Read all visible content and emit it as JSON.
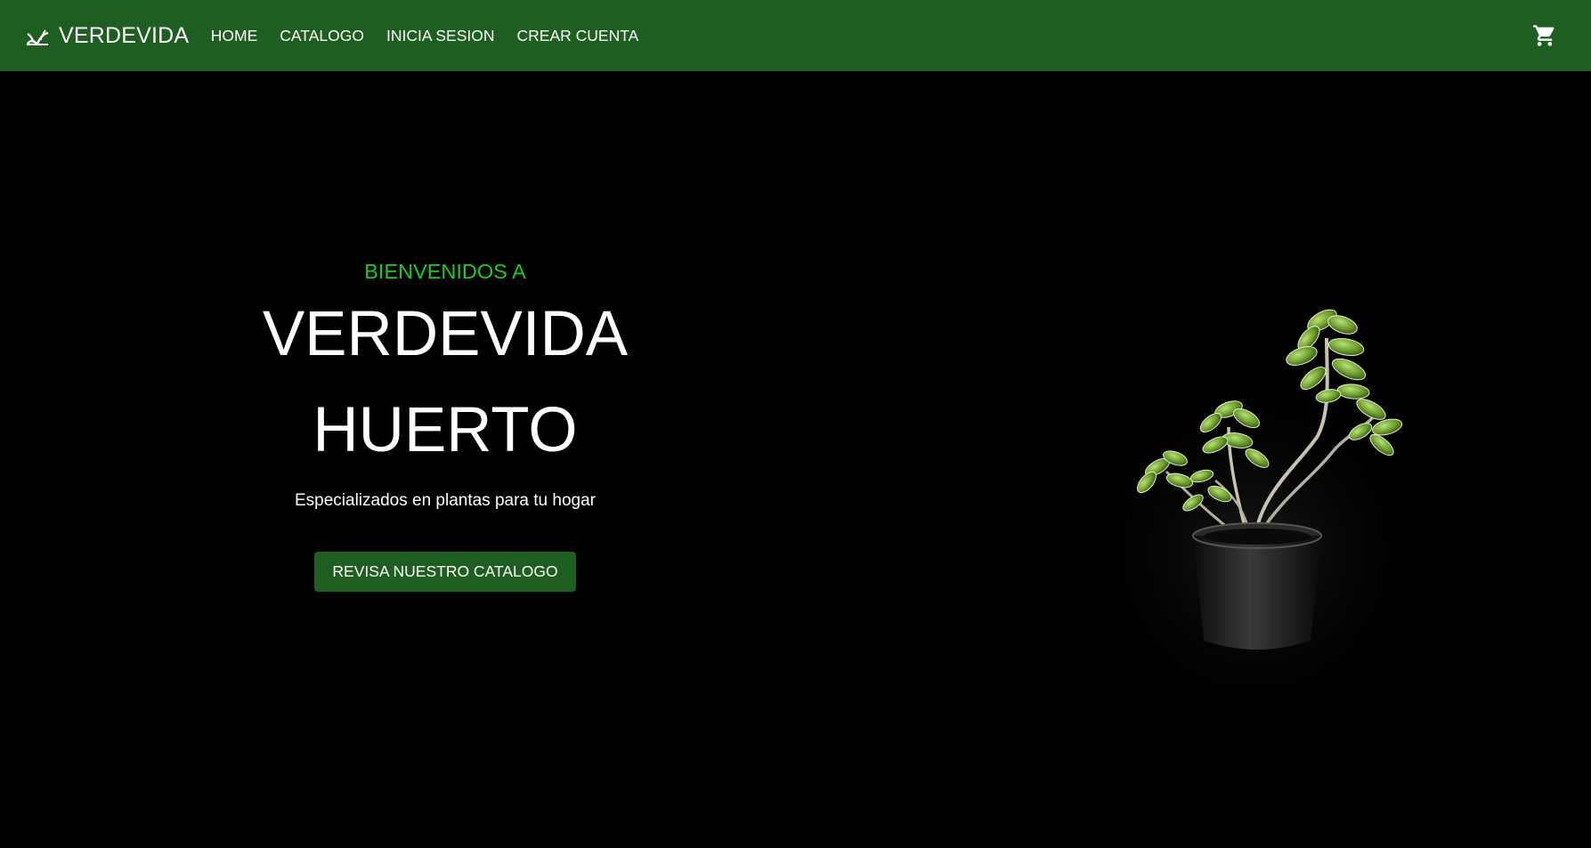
{
  "nav": {
    "brand": "VERDEVIDA",
    "links": [
      "HOME",
      "CATALOGO",
      "INICIA SESION",
      "CREAR CUENTA"
    ]
  },
  "hero": {
    "eyebrow": "BIENVENIDOS A",
    "title_line1": "VERDEVIDA",
    "title_line2": "HUERTO",
    "tagline": "Especializados en plantas para tu hogar",
    "cta_label": "REVISA NUESTRO CATALOGO"
  },
  "colors": {
    "navbar": "#1e5e20",
    "accent": "#1dcc21",
    "background": "#000000"
  },
  "icons": {
    "brand": "sprout-icon",
    "cart": "shopping-cart-icon"
  }
}
